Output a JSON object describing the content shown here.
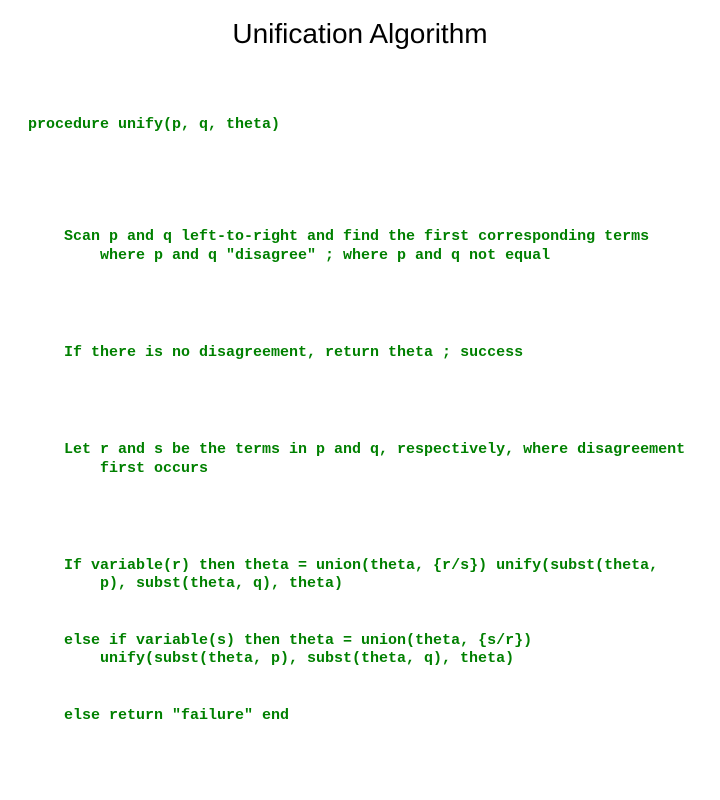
{
  "title": "Unification Algorithm",
  "proc_header": "procedure unify(p, q, theta)",
  "body": {
    "scan": "Scan p and q left-to-right and find the first corresponding terms where p and q \"disagree\" ; where p and q not equal",
    "no_disagree": "If there is no disagreement, return theta ; success",
    "let_rs": "Let r and s be the terms in p and q, respectively, where disagreement first occurs",
    "if_var_r": "If variable(r) then theta = union(theta, {r/s}) unify(subst(theta, p), subst(theta, q), theta)",
    "elif_var_s": "else if variable(s) then theta = union(theta, {s/r}) unify(subst(theta, p), subst(theta, q), theta)",
    "else_fail": "else return \"failure\" end"
  }
}
